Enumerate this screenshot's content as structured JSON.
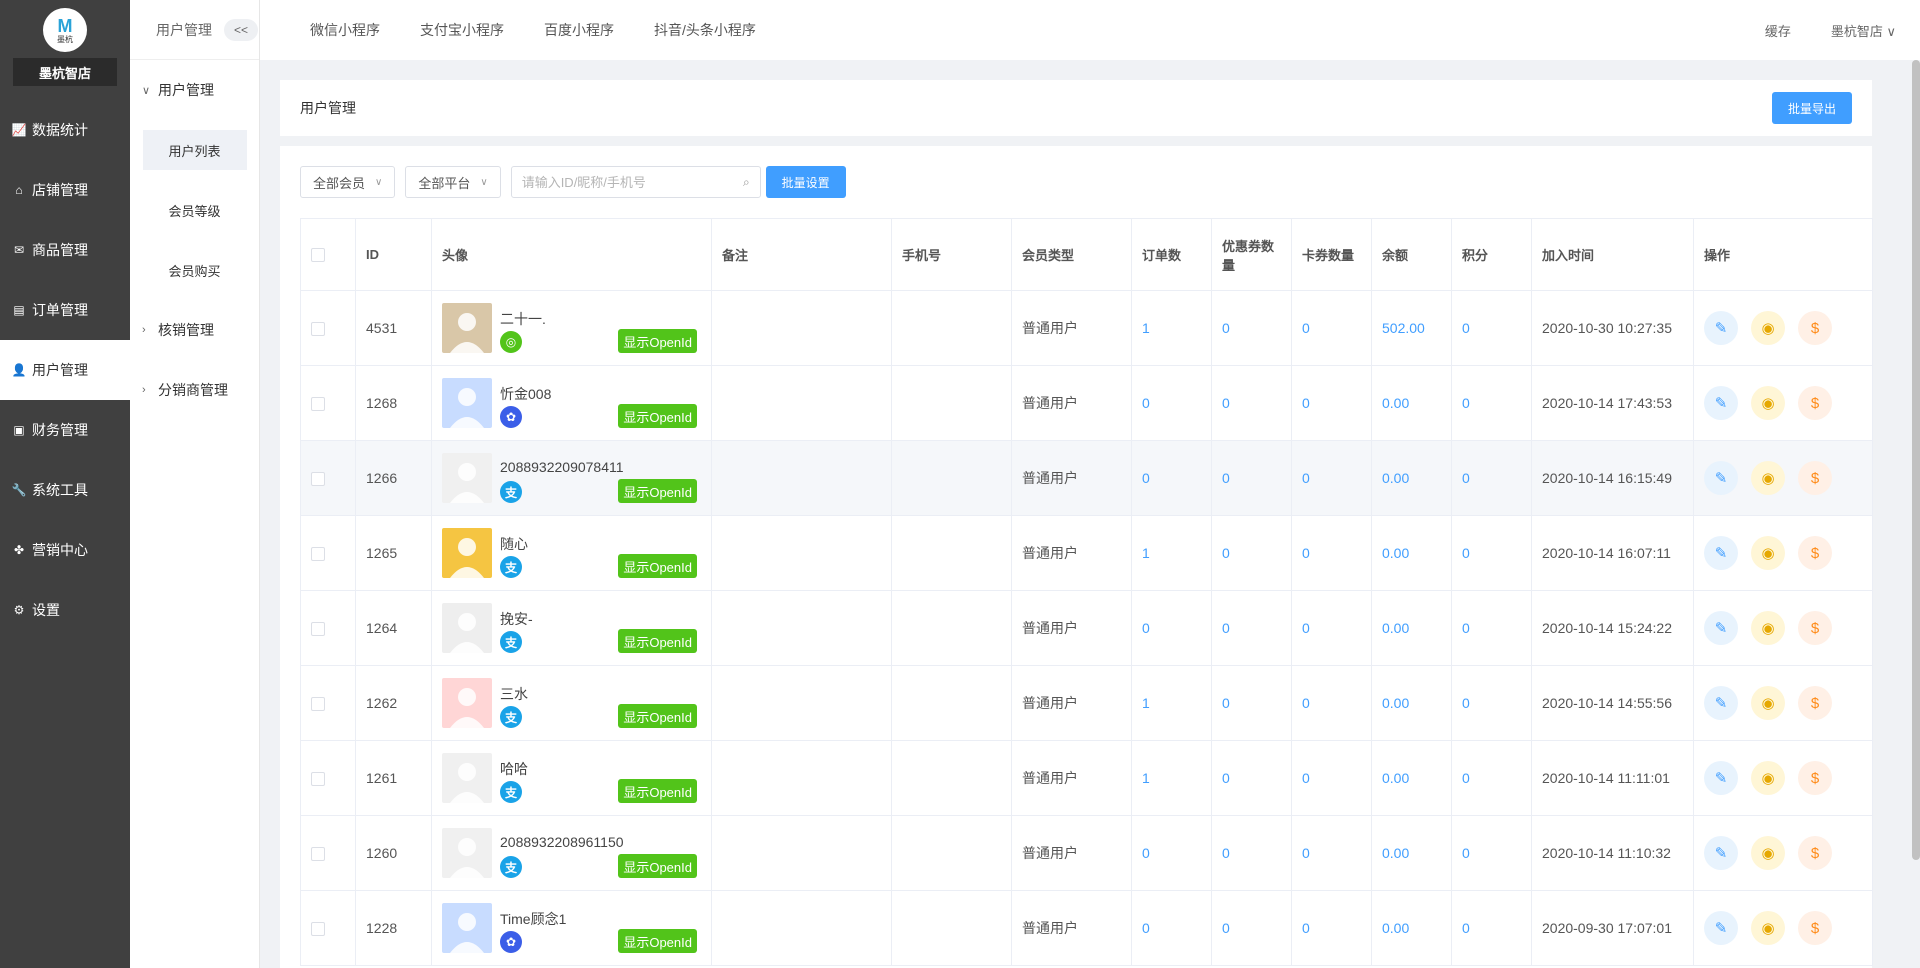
{
  "brand": {
    "logo_mark": "M",
    "logo_text": "墨杭",
    "shop_name": "墨杭智店"
  },
  "nav": [
    {
      "label": "数据统计",
      "icon": "chart-icon"
    },
    {
      "label": "店铺管理",
      "icon": "shop-icon"
    },
    {
      "label": "商品管理",
      "icon": "goods-icon"
    },
    {
      "label": "订单管理",
      "icon": "order-icon"
    },
    {
      "label": "用户管理",
      "icon": "user-icon",
      "active": true
    },
    {
      "label": "财务管理",
      "icon": "finance-icon"
    },
    {
      "label": "系统工具",
      "icon": "wrench-icon"
    },
    {
      "label": "营销中心",
      "icon": "marketing-icon"
    },
    {
      "label": "设置",
      "icon": "gear-icon"
    }
  ],
  "subnav": {
    "title": "用户管理",
    "collapse": "<<",
    "group1": "用户管理",
    "items": [
      "用户列表",
      "会员等级",
      "会员购买"
    ],
    "group2": "核销管理",
    "group3": "分销商管理"
  },
  "topbar": {
    "tabs": [
      "微信小程序",
      "支付宝小程序",
      "百度小程序",
      "抖音/头条小程序"
    ],
    "cache": "缓存",
    "account": "墨杭智店"
  },
  "page": {
    "title": "用户管理",
    "export": "批量导出"
  },
  "filters": {
    "member": "全部会员",
    "platform": "全部平台",
    "search_placeholder": "请输入ID/昵称/手机号",
    "batch": "批量设置"
  },
  "table": {
    "headers": [
      "",
      "ID",
      "头像",
      "备注",
      "手机号",
      "会员类型",
      "订单数",
      "优惠券数量",
      "卡券数量",
      "余额",
      "积分",
      "加入时间",
      "操作"
    ],
    "openid_label": "显示OpenId",
    "rows": [
      {
        "id": "4531",
        "name": "二十一.",
        "platform": "wx",
        "type": "普通用户",
        "orders": "1",
        "coupons": "0",
        "cards": "0",
        "balance": "502.00",
        "points": "0",
        "joined": "2020-10-30 10:27:35"
      },
      {
        "id": "1268",
        "name": "忻金008",
        "platform": "bd",
        "type": "普通用户",
        "orders": "0",
        "coupons": "0",
        "cards": "0",
        "balance": "0.00",
        "points": "0",
        "joined": "2020-10-14 17:43:53"
      },
      {
        "id": "1266",
        "name": "2088932209078411",
        "platform": "ali",
        "type": "普通用户",
        "orders": "0",
        "coupons": "0",
        "cards": "0",
        "balance": "0.00",
        "points": "0",
        "joined": "2020-10-14 16:15:49"
      },
      {
        "id": "1265",
        "name": "随心",
        "platform": "ali",
        "type": "普通用户",
        "orders": "1",
        "coupons": "0",
        "cards": "0",
        "balance": "0.00",
        "points": "0",
        "joined": "2020-10-14 16:07:11"
      },
      {
        "id": "1264",
        "name": "挽安-",
        "platform": "ali",
        "type": "普通用户",
        "orders": "0",
        "coupons": "0",
        "cards": "0",
        "balance": "0.00",
        "points": "0",
        "joined": "2020-10-14 15:24:22"
      },
      {
        "id": "1262",
        "name": "三水",
        "platform": "ali",
        "type": "普通用户",
        "orders": "1",
        "coupons": "0",
        "cards": "0",
        "balance": "0.00",
        "points": "0",
        "joined": "2020-10-14 14:55:56"
      },
      {
        "id": "1261",
        "name": "哈哈",
        "platform": "ali",
        "type": "普通用户",
        "orders": "1",
        "coupons": "0",
        "cards": "0",
        "balance": "0.00",
        "points": "0",
        "joined": "2020-10-14 11:11:01"
      },
      {
        "id": "1260",
        "name": "2088932208961150",
        "platform": "ali",
        "type": "普通用户",
        "orders": "0",
        "coupons": "0",
        "cards": "0",
        "balance": "0.00",
        "points": "0",
        "joined": "2020-10-14 11:10:32"
      },
      {
        "id": "1228",
        "name": "Time顾念1",
        "platform": "bd",
        "type": "普通用户",
        "orders": "0",
        "coupons": "0",
        "cards": "0",
        "balance": "0.00",
        "points": "0",
        "joined": "2020-09-30 17:07:01"
      }
    ]
  },
  "platform_glyphs": {
    "wx": "◎",
    "bd": "✿",
    "ali": "支"
  },
  "colors": {
    "primary": "#409eff",
    "openid": "#52c41a",
    "sidebar": "#404040"
  }
}
